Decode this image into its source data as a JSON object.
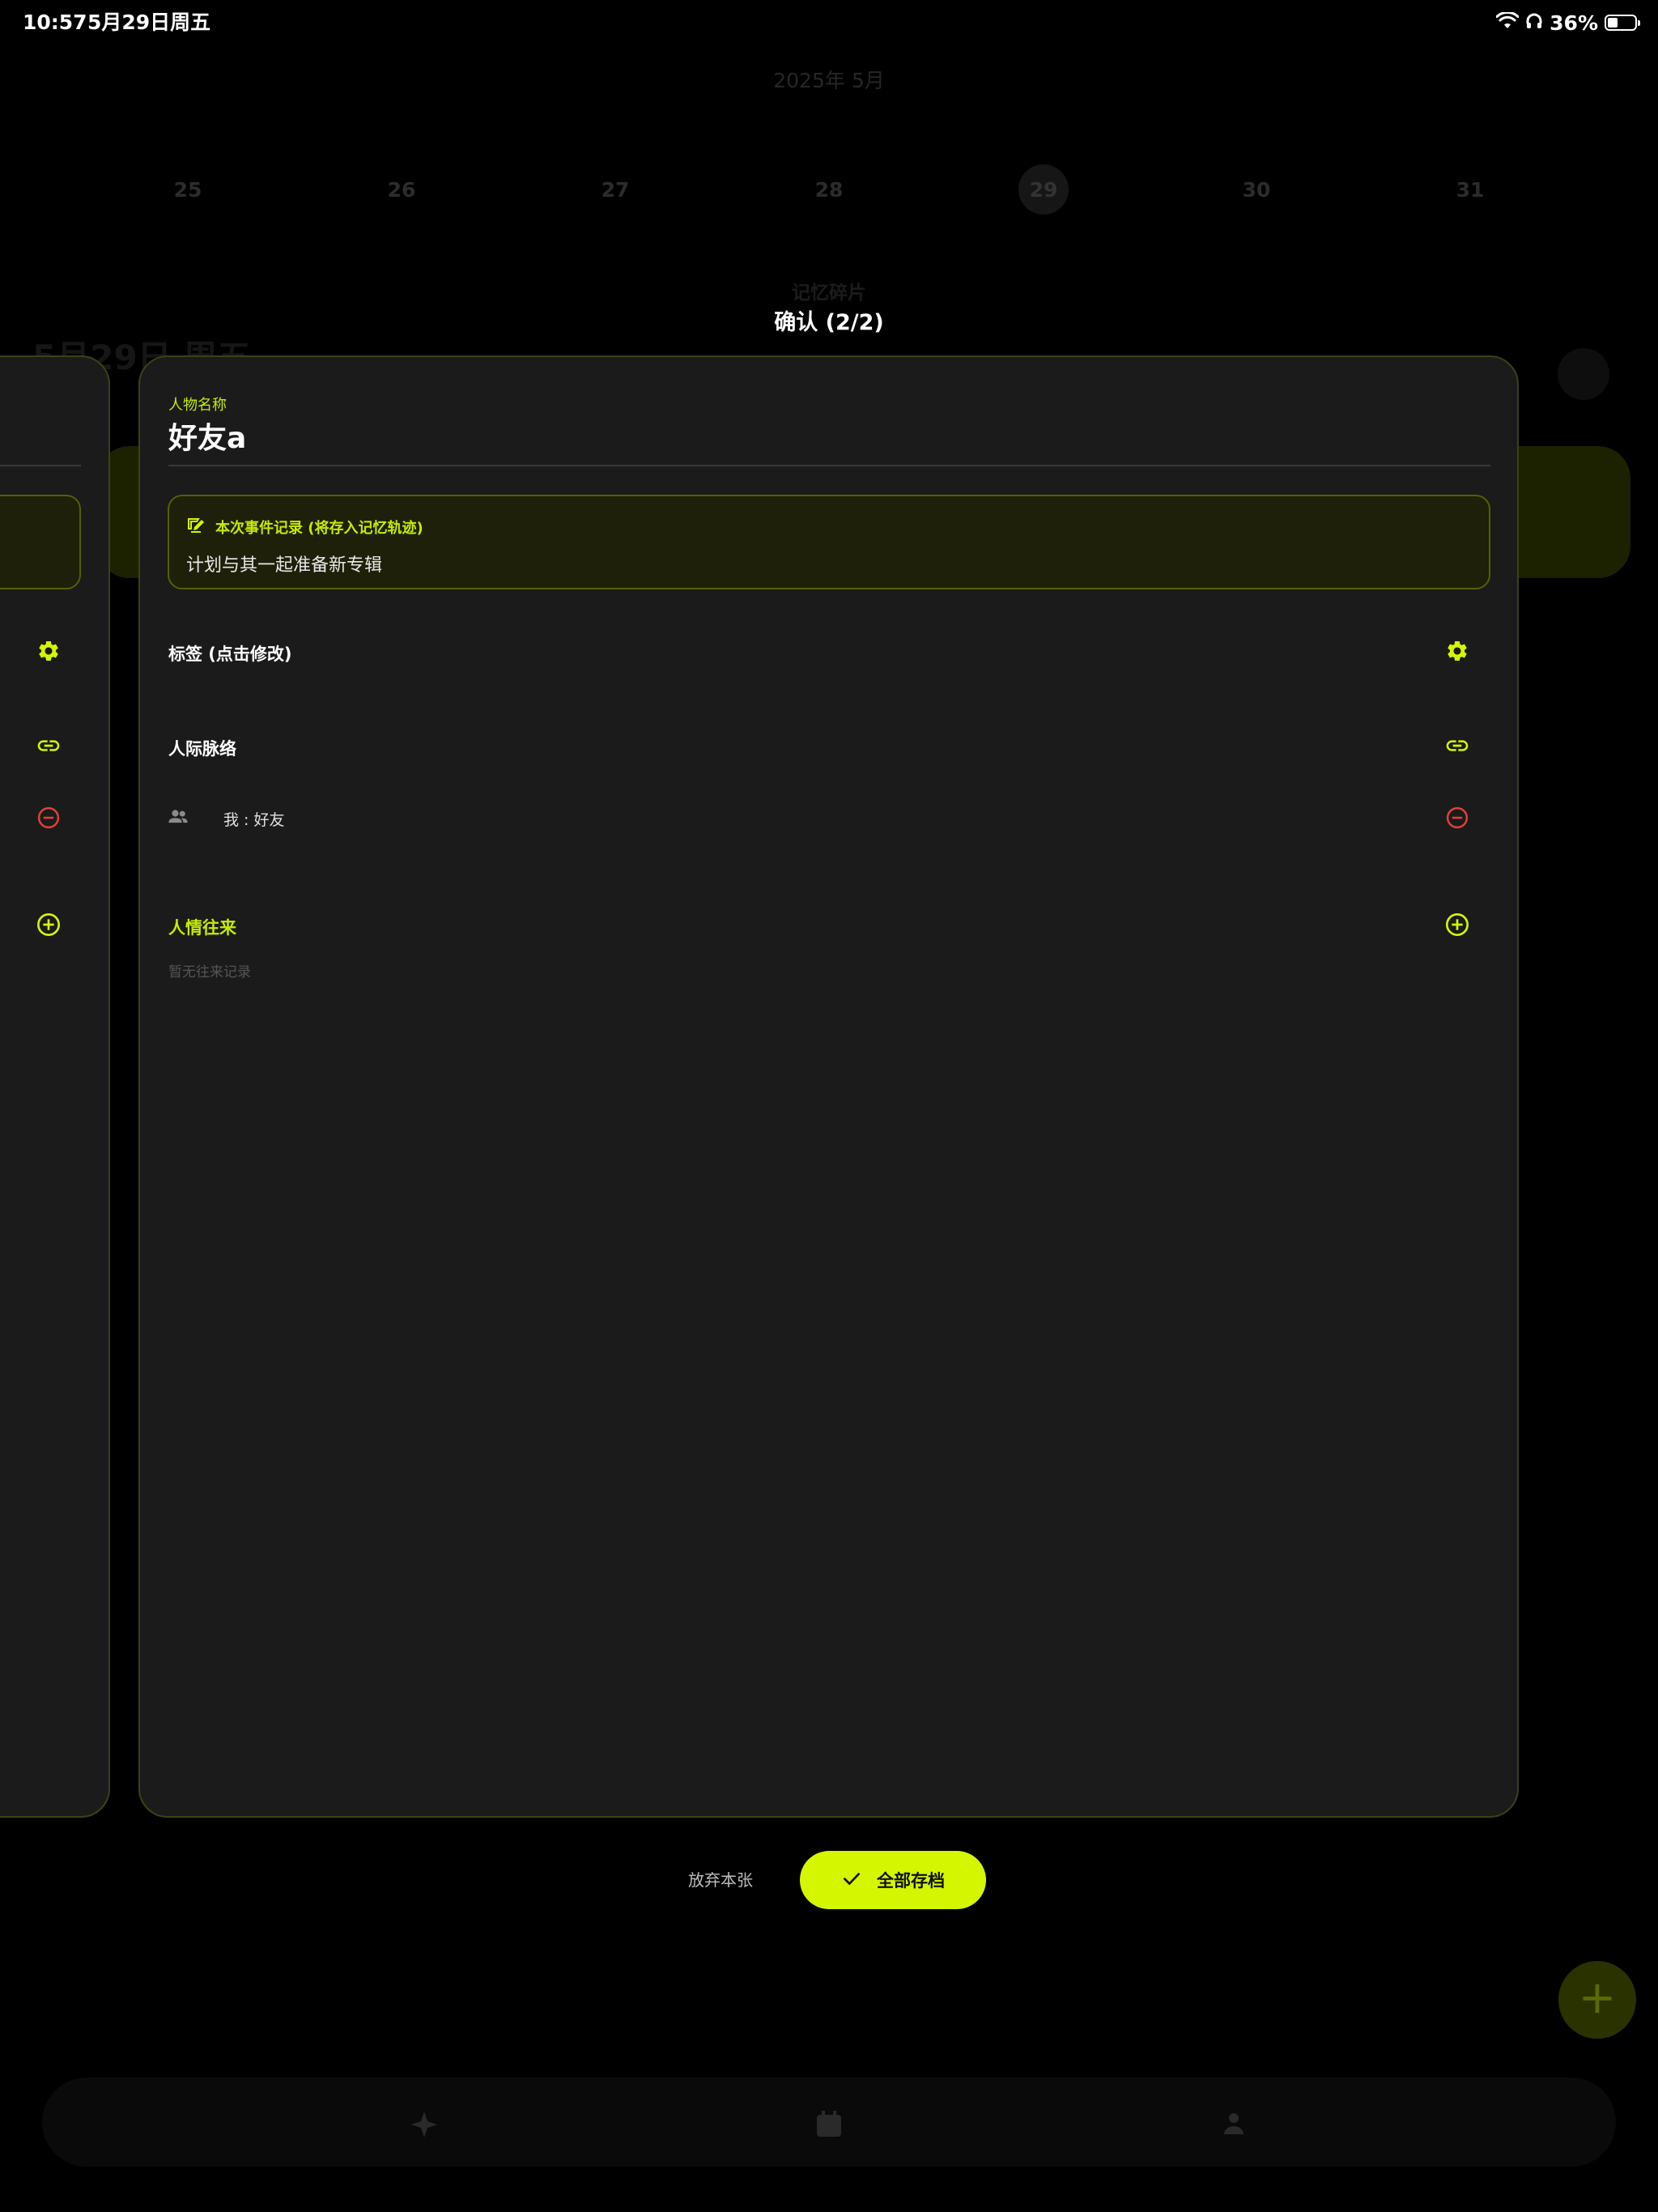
{
  "status_bar": {
    "time": "10:57",
    "date": "5月29日周五",
    "battery": "36%",
    "battery_level_percent": 36
  },
  "background": {
    "month_title": "2025年 5月",
    "days": [
      "25",
      "26",
      "27",
      "28",
      "29",
      "30",
      "31"
    ],
    "selected_day": "29",
    "date_heading": "5月29日 周五",
    "section_tag": "记忆碎片"
  },
  "dialog": {
    "title": "确认 (2/2)",
    "name_label": "人物名称",
    "name_value": "好友a",
    "event_title": "本次事件记录 (将存入记忆轨迹)",
    "event_text": "计划与其一起准备新专辑",
    "tags_label": "标签 (点击修改)",
    "network_label": "人际脉络",
    "relation_text": "我 : 好友",
    "exchange_label": "人情往来",
    "exchange_empty": "暂无往来记录"
  },
  "actions": {
    "discard_label": "放弃本张",
    "save_all_label": "全部存档"
  },
  "colors": {
    "accent": "#d4f700",
    "danger": "#e0413b",
    "background": "#000000",
    "card": "#1b1b1b"
  },
  "icons": [
    "wifi-icon",
    "headphones-icon",
    "battery-icon",
    "document-edit-icon",
    "gear-icon",
    "link-icon",
    "people-icon",
    "minus-circle-icon",
    "plus-circle-icon",
    "check-icon",
    "calendar-icon",
    "plus-icon",
    "star-icon",
    "person-icon"
  ]
}
